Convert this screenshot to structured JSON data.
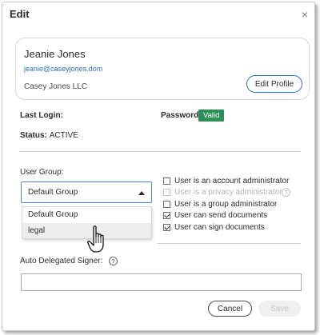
{
  "dialog": {
    "title": "Edit",
    "close_glyph": "×"
  },
  "profile": {
    "name": "Jeanie Jones",
    "email": "jeanie@caseyjones.dom",
    "company": "Casey Jones LLC",
    "edit_button": "Edit Profile"
  },
  "info": {
    "last_login_label": "Last Login:",
    "password_label": "Password:",
    "password_status": "Valid",
    "status_label": "Status:",
    "status_value": "ACTIVE"
  },
  "user_group": {
    "label": "User Group:",
    "selected": "Default Group",
    "options": [
      "Default Group",
      "legal"
    ],
    "hovered_option": "legal"
  },
  "permissions": [
    {
      "label": "User is an account administrator",
      "checked": false,
      "disabled": false
    },
    {
      "label": "User is a privacy administrator",
      "checked": false,
      "disabled": true,
      "help": true
    },
    {
      "label": "User is a group administrator",
      "checked": false,
      "disabled": false
    },
    {
      "label": "User can send documents",
      "checked": true,
      "disabled": false
    },
    {
      "label": "User can sign documents",
      "checked": true,
      "disabled": false
    }
  ],
  "auto_delegated": {
    "label": "Auto Delegated Signer:",
    "help_glyph": "?",
    "value": ""
  },
  "footer": {
    "cancel": "Cancel",
    "save": "Save"
  },
  "colors": {
    "accent": "#2d6fc0",
    "valid_badge": "#2f8f58"
  },
  "icons": {
    "close": "close-icon",
    "caret": "caret-up-icon",
    "help": "help-icon",
    "cursor": "hand-cursor-icon"
  }
}
